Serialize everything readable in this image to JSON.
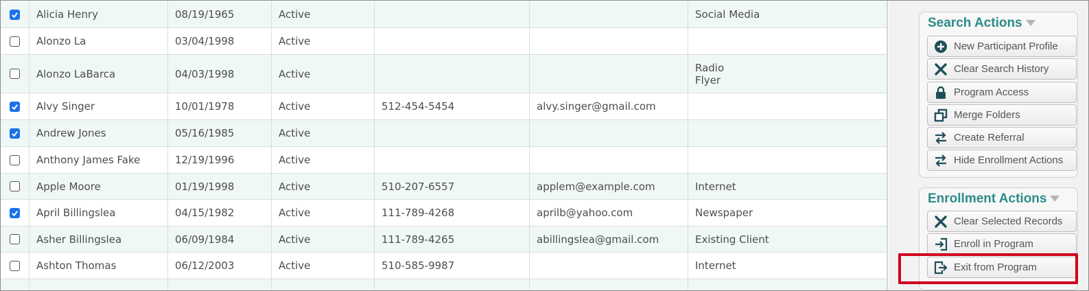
{
  "table": {
    "rows": [
      {
        "checked": true,
        "name": "Alicia Henry",
        "dob": "08/19/1965",
        "status": "Active",
        "phone": "",
        "email": "",
        "source": [
          "Social Media"
        ]
      },
      {
        "checked": false,
        "name": "Alonzo La",
        "dob": "03/04/1998",
        "status": "Active",
        "phone": "",
        "email": "",
        "source": []
      },
      {
        "checked": false,
        "name": "Alonzo LaBarca",
        "dob": "04/03/1998",
        "status": "Active",
        "phone": "",
        "email": "",
        "source": [
          "Radio",
          "Flyer"
        ]
      },
      {
        "checked": true,
        "name": "Alvy Singer",
        "dob": "10/01/1978",
        "status": "Active",
        "phone": "512-454-5454",
        "email": "alvy.singer@gmail.com",
        "source": []
      },
      {
        "checked": true,
        "name": "Andrew Jones",
        "dob": "05/16/1985",
        "status": "Active",
        "phone": "",
        "email": "",
        "source": []
      },
      {
        "checked": false,
        "name": "Anthony James Fake",
        "dob": "12/19/1996",
        "status": "Active",
        "phone": "",
        "email": "",
        "source": []
      },
      {
        "checked": false,
        "name": "Apple Moore",
        "dob": "01/19/1998",
        "status": "Active",
        "phone": "510-207-6557",
        "email": "applem@example.com",
        "source": [
          "Internet"
        ]
      },
      {
        "checked": true,
        "name": "April Billingslea",
        "dob": "04/15/1982",
        "status": "Active",
        "phone": "111-789-4268",
        "email": "aprilb@yahoo.com",
        "source": [
          "Newspaper"
        ]
      },
      {
        "checked": false,
        "name": "Asher Billingslea",
        "dob": "06/09/1984",
        "status": "Active",
        "phone": "111-789-4265",
        "email": "abillingslea@gmail.com",
        "source": [
          "Existing Client"
        ]
      },
      {
        "checked": false,
        "name": "Ashton Thomas",
        "dob": "06/12/2003",
        "status": "Active",
        "phone": "510-585-9987",
        "email": "",
        "source": [
          "Internet"
        ]
      }
    ]
  },
  "search_actions": {
    "title": "Search Actions",
    "buttons": [
      {
        "label": "New Participant Profile",
        "icon": "plus-circle-icon"
      },
      {
        "label": "Clear Search History",
        "icon": "x-icon"
      },
      {
        "label": "Program Access",
        "icon": "lock-icon"
      },
      {
        "label": "Merge Folders",
        "icon": "merge-icon"
      },
      {
        "label": "Create Referral",
        "icon": "arrows-exchange-icon"
      },
      {
        "label": "Hide Enrollment Actions",
        "icon": "arrows-exchange-icon"
      }
    ]
  },
  "enrollment_actions": {
    "title": "Enrollment Actions",
    "buttons": [
      {
        "label": "Clear Selected Records",
        "icon": "x-icon"
      },
      {
        "label": "Enroll in Program",
        "icon": "enter-icon"
      },
      {
        "label": "Exit from Program",
        "icon": "exit-icon"
      }
    ]
  },
  "colors": {
    "accent": "#2e8b8b",
    "icon": "#1f4e5a",
    "highlight": "#d0021b",
    "checkbox": "#1a73e8"
  }
}
